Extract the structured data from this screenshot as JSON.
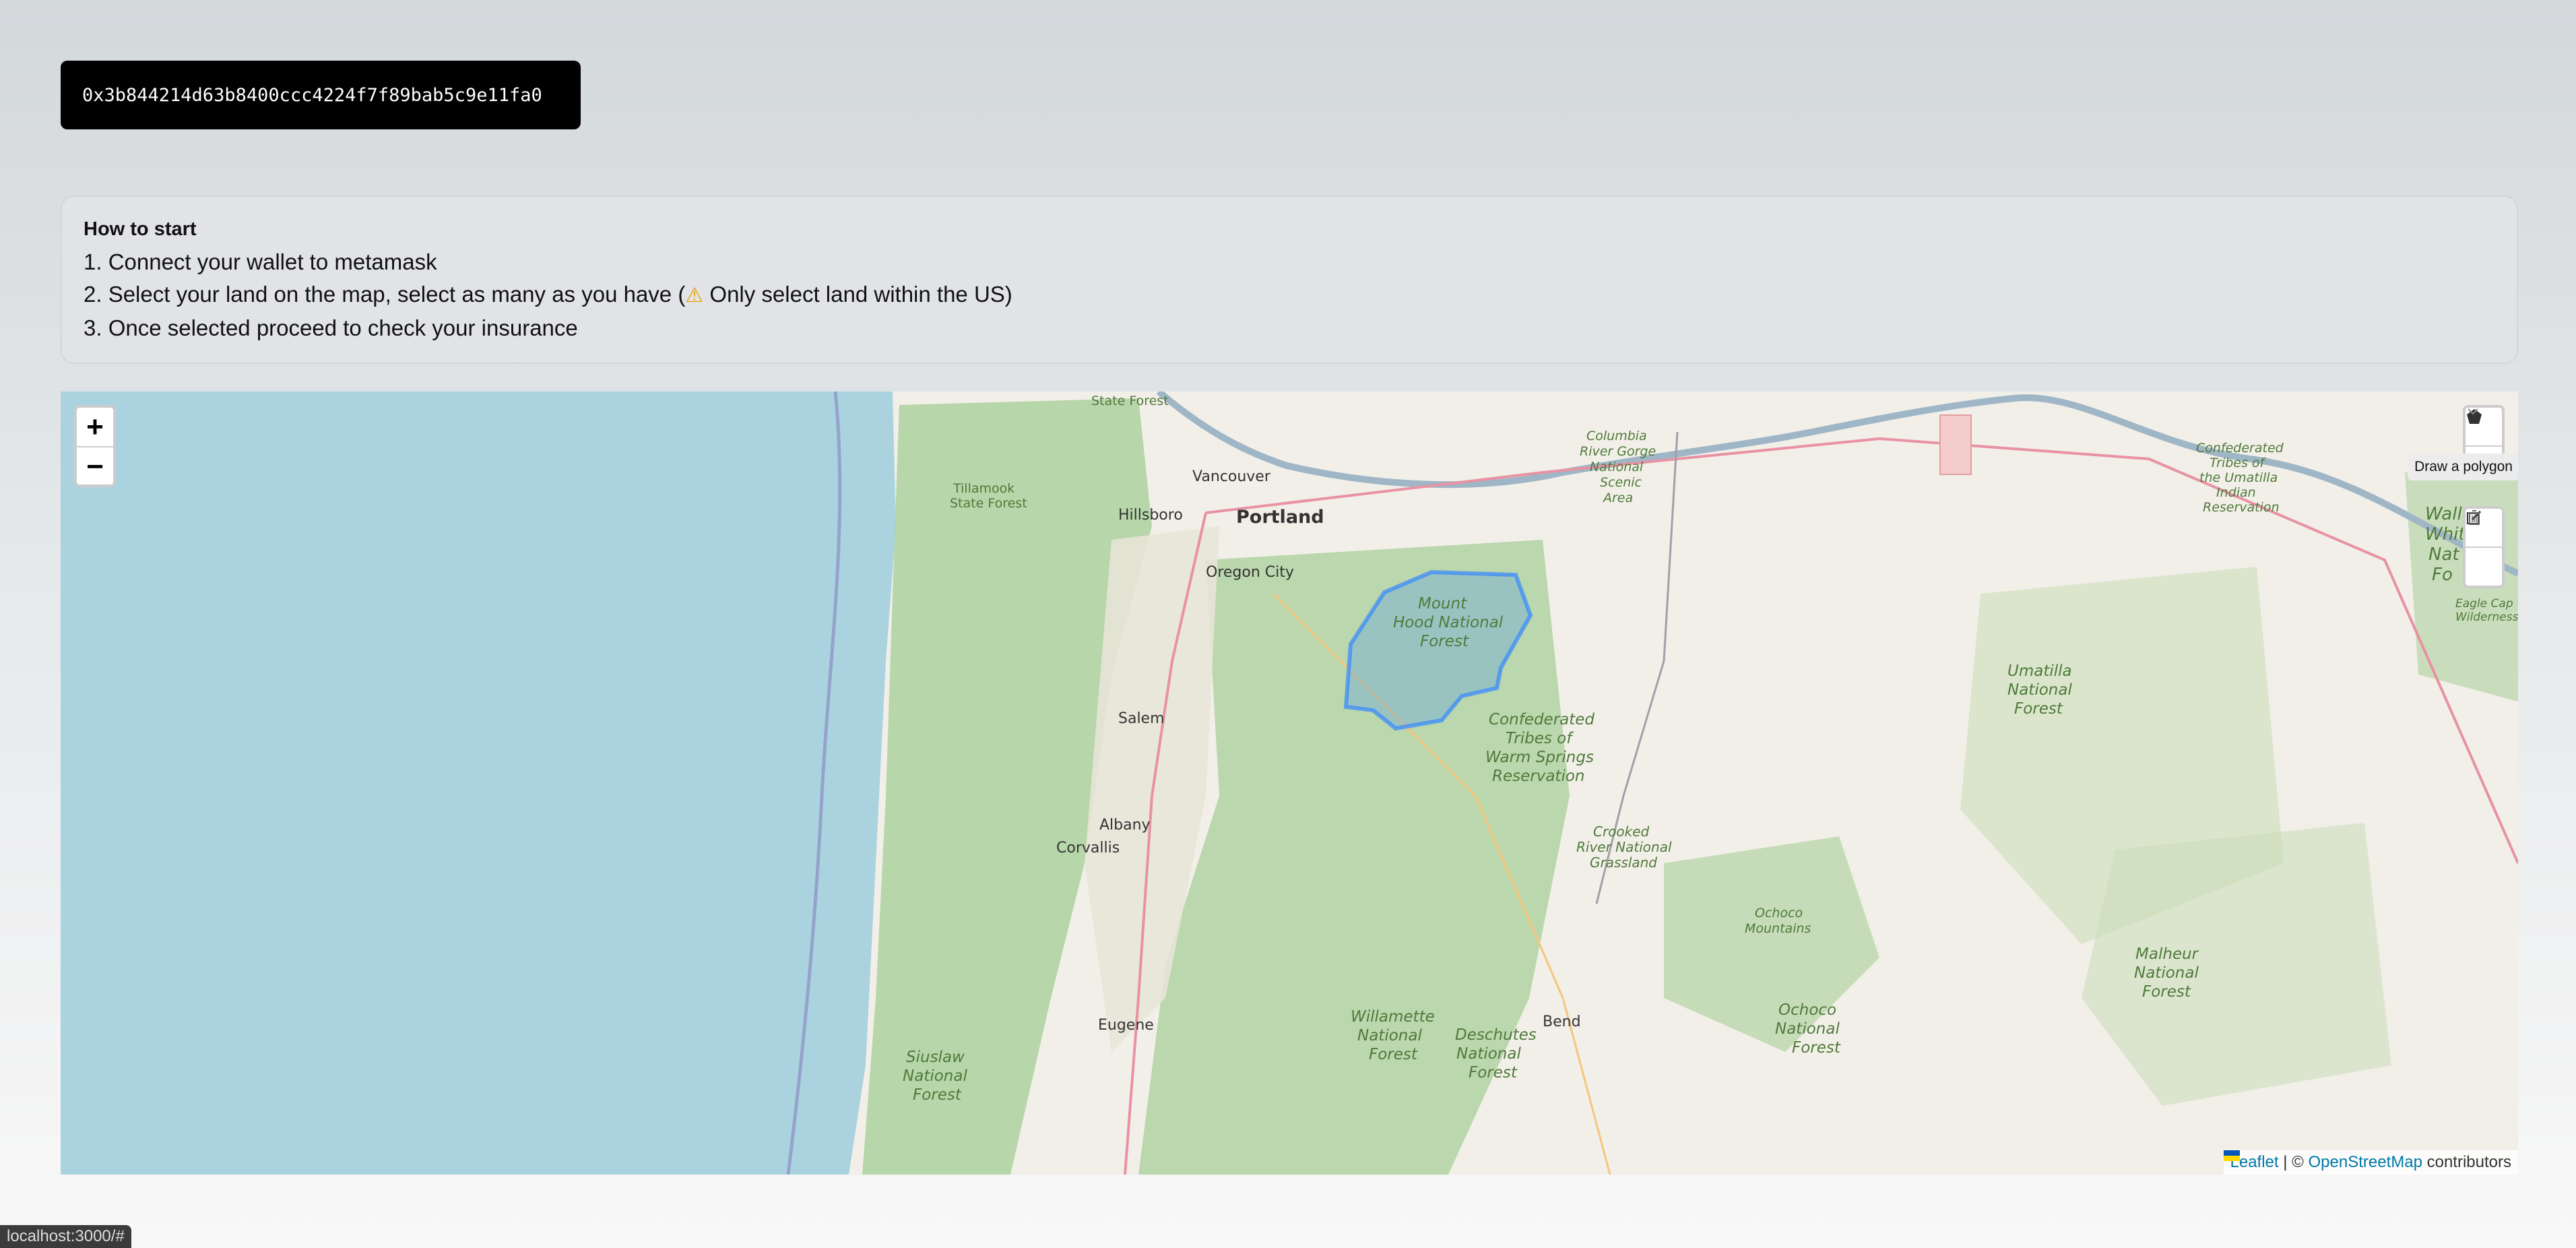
{
  "wallet": {
    "address": "0x3b844214d63b8400ccc4224f7f89bab5c9e11fa0"
  },
  "howto": {
    "title": "How to start",
    "step1": "1. Connect your wallet to metamask",
    "step2_a": "2. Select your land on the map, select as many as you have (",
    "step2_b": " Only select land within the US)",
    "step3": "3. Once selected proceed to check your insurance"
  },
  "map": {
    "zoom_in": "+",
    "zoom_out": "−",
    "draw_polygon_tooltip": "Draw a polygon",
    "attribution": {
      "leaflet": "Leaflet",
      "sep": " | © ",
      "osm": "OpenStreetMap",
      "contributors": " contributors"
    },
    "labels": {
      "state_forest": "State Forest",
      "vancouver": "Vancouver",
      "hillsboro": "Hillsboro",
      "portland": "Portland",
      "oregon_city": "Oregon City",
      "tillamook": "Tillamook",
      "tillamook2": "State Forest",
      "salem": "Salem",
      "albany": "Albany",
      "corvallis": "Corvallis",
      "eugene": "Eugene",
      "bend": "Bend",
      "mt_hood_1": "Mount",
      "mt_hood_2": "Hood National",
      "mt_hood_3": "Forest",
      "warm_1": "Confederated",
      "warm_2": "Tribes of",
      "warm_3": "Warm Springs",
      "warm_4": "Reservation",
      "columbia_1": "Columbia",
      "columbia_2": "River Gorge",
      "columbia_3": "National",
      "columbia_4": "Scenic",
      "columbia_5": "Area",
      "umatilla_1": "Umatilla",
      "umatilla_2": "National",
      "umatilla_3": "Forest",
      "umatilla_res_1": "Confederated",
      "umatilla_res_2": "Tribes of",
      "umatilla_res_3": "the Umatilla",
      "umatilla_res_4": "Indian",
      "umatilla_res_5": "Reservation",
      "crooked_1": "Crooked",
      "crooked_2": "River National",
      "crooked_3": "Grassland",
      "ochoco_mtns_1": "Ochoco",
      "ochoco_mtns_2": "Mountains",
      "ochoco_1": "Ochoco",
      "ochoco_2": "National",
      "ochoco_3": "Forest",
      "malheur_1": "Malheur",
      "malheur_2": "National",
      "malheur_3": "Forest",
      "willamette_1": "Willamette",
      "willamette_2": "National",
      "willamette_3": "Forest",
      "deschutes_1": "Deschutes",
      "deschutes_2": "National",
      "deschutes_3": "Forest",
      "siuslaw_1": "Siuslaw",
      "siuslaw_2": "National",
      "siuslaw_3": "Forest",
      "wallowa_1": "Wallo",
      "wallowa_2": "Whit",
      "wallowa_3": "Nat",
      "wallowa_4": "Fo",
      "eagle_1": "Eagle Cap",
      "eagle_2": "Wilderness"
    }
  },
  "status_bar": {
    "url": "localhost:3000/#"
  },
  "colors": {
    "water": "#aad3df",
    "land": "#f2efe9",
    "forest": "#add19e",
    "polygon": "#3388ff"
  }
}
